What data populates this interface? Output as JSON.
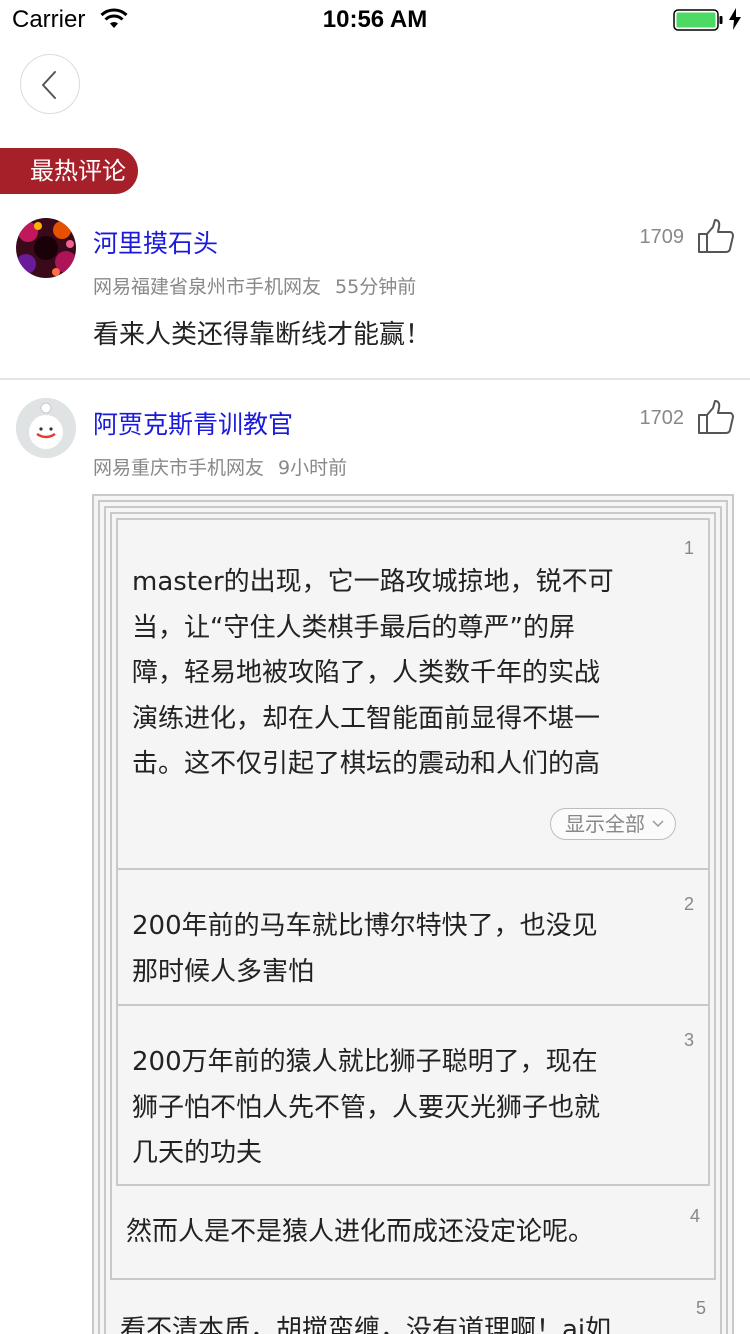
{
  "status_bar": {
    "carrier": "Carrier",
    "time": "10:56 AM",
    "battery_color": "#4cd964"
  },
  "nav": {
    "back_icon": "chevron-left-icon"
  },
  "section": {
    "hot_label": "最热评论",
    "accent_color": "#a6202a"
  },
  "comments": [
    {
      "username": "河里摸石头",
      "location": "网易福建省泉州市手机网友",
      "time": "55分钟前",
      "likes": "1709",
      "text": "看来人类还得靠断线才能赢！"
    },
    {
      "username": "阿贾克斯青训教官",
      "location": "网易重庆市手机网友",
      "time": "9小时前",
      "likes": "1702",
      "floors": [
        {
          "num": "1",
          "lines": [
            "master的出现，它一路攻城掠地，锐不可",
            "当，让“守住人类棋手最后的尊严”的屏",
            "障，轻易地被攻陷了，人类数千年的实战",
            "演练进化，却在人工智能面前显得不堪一",
            "击。这不仅引起了棋坛的震动和人们的高"
          ],
          "show_all": "显示全部"
        },
        {
          "num": "2",
          "lines": [
            "200年前的马车就比博尔特快了，也没见",
            "那时候人多害怕"
          ]
        },
        {
          "num": "3",
          "lines": [
            "200万年前的猿人就比狮子聪明了，现在",
            "狮子怕不怕人先不管，人要灭光狮子也就",
            "几天的功夫"
          ]
        },
        {
          "num": "4",
          "lines": [
            "然而人是不是猿人进化而成还没定论呢。"
          ]
        },
        {
          "num": "5",
          "lines": [
            "看不清本质，胡搅蛮缠，没有道理啊！ai如"
          ]
        }
      ]
    }
  ]
}
